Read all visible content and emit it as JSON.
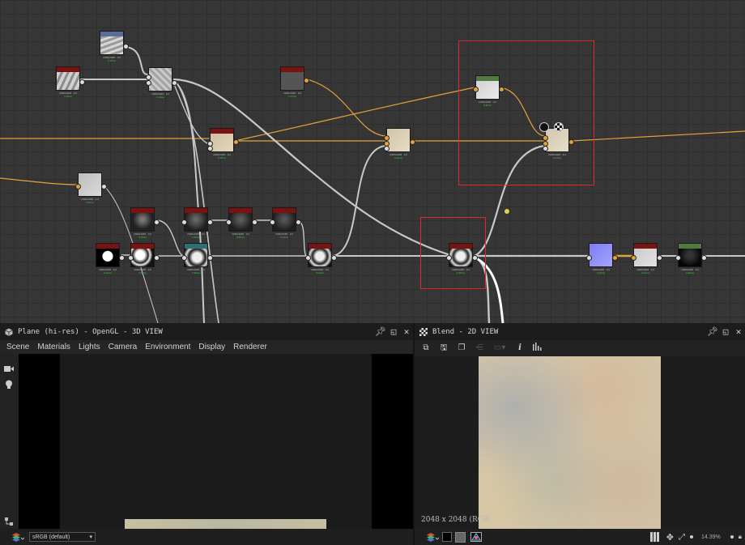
{
  "graph": {
    "node_labels": [
      {
        "id": "n1",
        "text": "2048x2048 · 1/4",
        "time": "0.15ms"
      },
      {
        "id": "n2",
        "text": "2048x2048 · 1/4",
        "time": "0.18ms"
      },
      {
        "id": "n3",
        "text": "2048x2048 · 1/4",
        "time": "0.19ms"
      },
      {
        "id": "n4",
        "text": "2048x2048 · 1/4",
        "time": "0.13ms"
      },
      {
        "id": "n5",
        "text": "2048x2048 · 1/4",
        "time": "0.26ms"
      },
      {
        "id": "n6",
        "text": "2048x2048 · 1/4",
        "time": "0.35ms"
      },
      {
        "id": "n7",
        "text": "2048x2048 · 1/4",
        "time": "0.19ms"
      },
      {
        "id": "n8",
        "text": "2048x2048 · 1/4",
        "time": "0.14ms"
      },
      {
        "id": "n9",
        "text": "2048x2048 · 1/4",
        "time": "0.53ms"
      },
      {
        "id": "n10",
        "text": "2048x2048 · 1/4",
        "time": "0.19ms"
      },
      {
        "id": "n11",
        "text": "2048x2048 · 1/4",
        "time": "0.29ms"
      },
      {
        "id": "n12",
        "text": "2048x2048 · 1/4",
        "time": "0.25ms"
      },
      {
        "id": "n13",
        "text": "2048x2048 · 1/4",
        "time": "0.13ms"
      },
      {
        "id": "n14",
        "text": "2048x2048 · 1/4",
        "time": "0.10ms"
      },
      {
        "id": "n15",
        "text": "2048x2048 · 1/4",
        "time": "0.43ms"
      },
      {
        "id": "n16",
        "text": "2048x2048 · 1/4",
        "time": "0.54ms"
      },
      {
        "id": "n17",
        "text": "2048x2048 · 1/4",
        "time": "0.34ms"
      },
      {
        "id": "n18",
        "text": "2048x2048 · 1/4",
        "time": "0.36ms"
      },
      {
        "id": "n19",
        "text": "2048x2048 · 1/4",
        "time": "0.22ms"
      },
      {
        "id": "n20",
        "text": "2048x2048 · 1/4",
        "time": "0.14ms"
      },
      {
        "id": "n21",
        "text": "2048x2048 · 1/4",
        "time": "0.35ms"
      },
      {
        "id": "n22",
        "text": "2048x2048 · 1/4",
        "time": "0.15ms"
      }
    ],
    "colors": {
      "wire_gray": "#c8c8c8",
      "wire_orange": "#e3a23a",
      "selection": "#e0282a"
    }
  },
  "view3d": {
    "title": "Plane (hi-res) - OpenGL - 3D VIEW",
    "menu": [
      "Scene",
      "Materials",
      "Lights",
      "Camera",
      "Environment",
      "Display",
      "Renderer"
    ],
    "colorspace": "sRGB (default)"
  },
  "view2d": {
    "title": "Blend - 2D VIEW",
    "info": "2048 x 2048 (RGB",
    "zoom": "14.39%"
  }
}
